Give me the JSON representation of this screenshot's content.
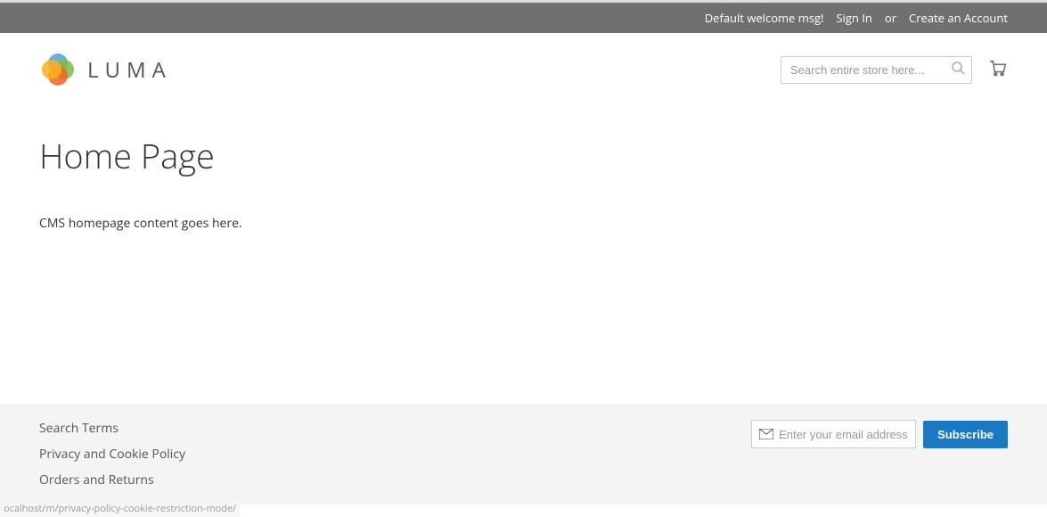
{
  "header": {
    "welcome_msg": "Default welcome msg!",
    "sign_in": "Sign In",
    "or": "or",
    "create_account": "Create an Account"
  },
  "logo": {
    "text": "LUMA"
  },
  "search": {
    "placeholder": "Search entire store here..."
  },
  "main": {
    "title": "Home Page",
    "content": "CMS homepage content goes here."
  },
  "footer": {
    "links": [
      "Search Terms",
      "Privacy and Cookie Policy",
      "Orders and Returns"
    ]
  },
  "newsletter": {
    "placeholder": "Enter your email address",
    "button": "Subscribe"
  },
  "status_url": "ocalhost/m/privacy-policy-cookie-restriction-mode/"
}
